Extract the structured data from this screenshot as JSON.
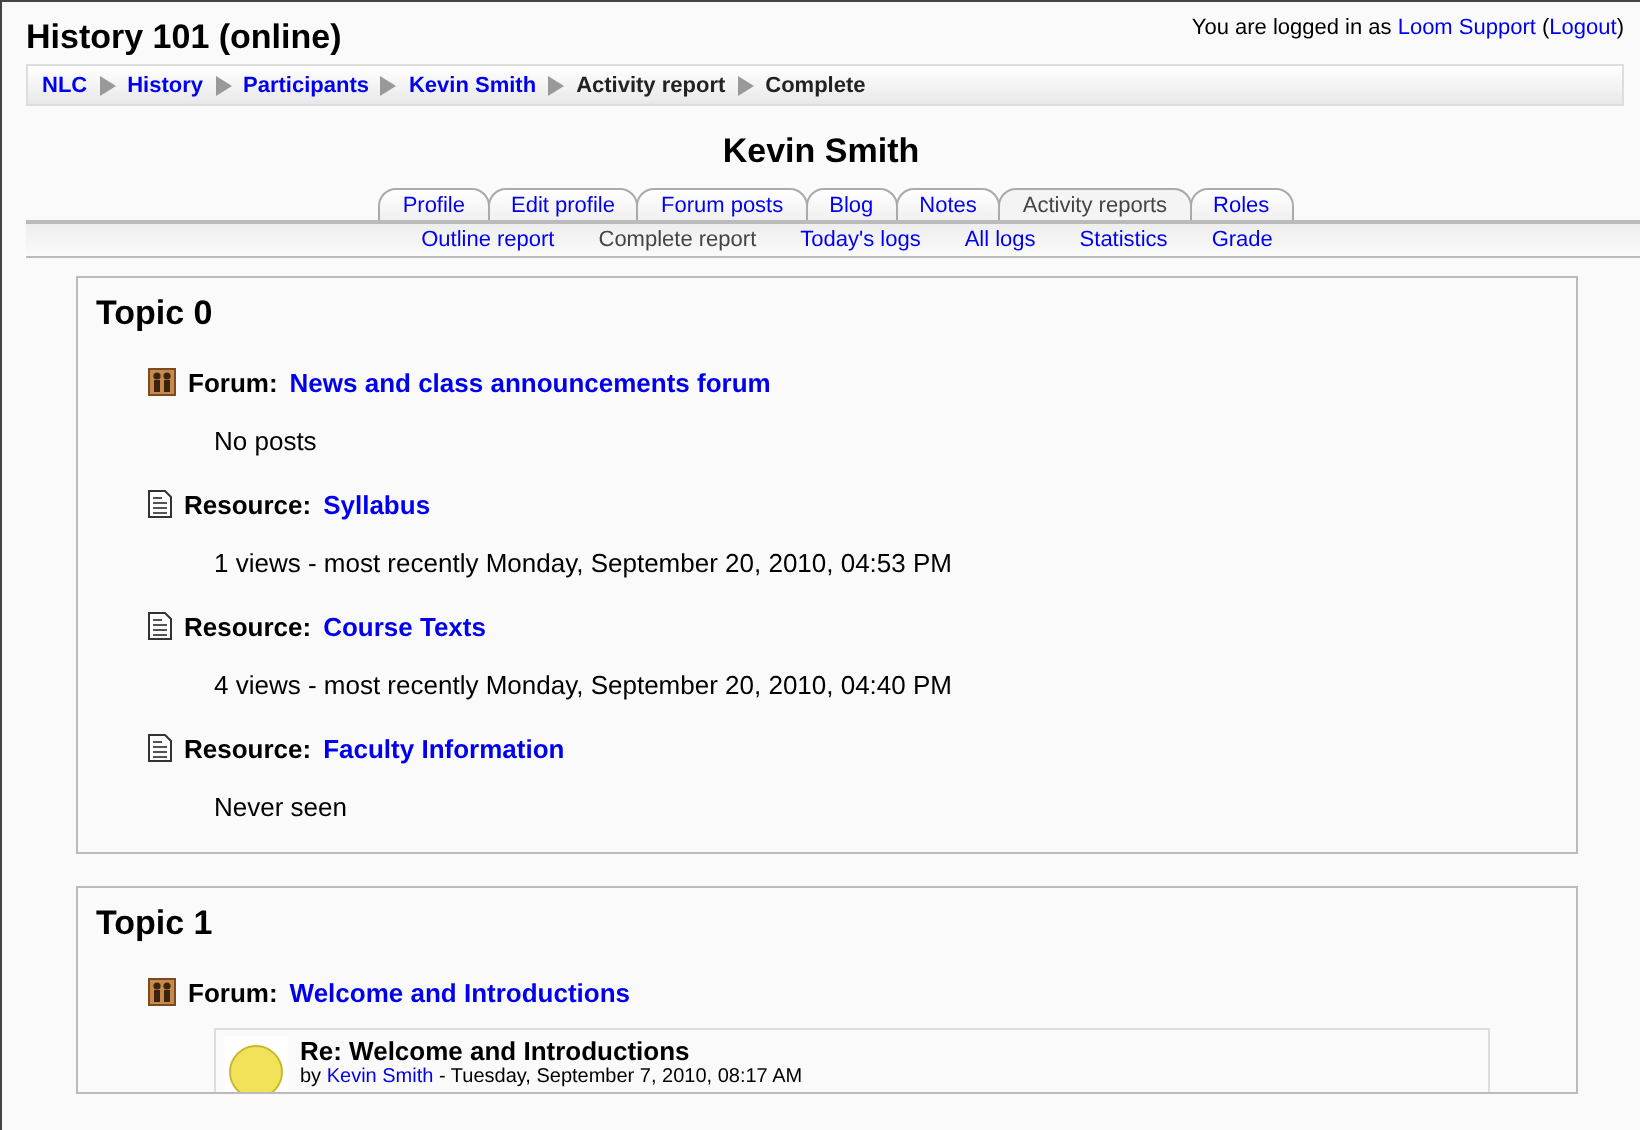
{
  "header": {
    "title": "History 101 (online)",
    "login_text": "You are logged in as",
    "user_link": "Loom Support",
    "logout_open": "(",
    "logout_link": "Logout",
    "logout_close": ")"
  },
  "breadcrumb": [
    {
      "label": "NLC",
      "link": true
    },
    {
      "label": "History",
      "link": true
    },
    {
      "label": "Participants",
      "link": true
    },
    {
      "label": "Kevin Smith",
      "link": true
    },
    {
      "label": "Activity report",
      "link": false
    },
    {
      "label": "Complete",
      "link": false
    }
  ],
  "page_title": "Kevin Smith",
  "tabs": [
    {
      "label": "Profile",
      "selected": false
    },
    {
      "label": "Edit profile",
      "selected": false
    },
    {
      "label": "Forum posts",
      "selected": false
    },
    {
      "label": "Blog",
      "selected": false
    },
    {
      "label": "Notes",
      "selected": false
    },
    {
      "label": "Activity reports",
      "selected": true
    },
    {
      "label": "Roles",
      "selected": false
    }
  ],
  "subtabs": [
    {
      "label": "Outline report",
      "selected": false
    },
    {
      "label": "Complete report",
      "selected": true
    },
    {
      "label": "Today's logs",
      "selected": false
    },
    {
      "label": "All logs",
      "selected": false
    },
    {
      "label": "Statistics",
      "selected": false
    },
    {
      "label": "Grade",
      "selected": false
    }
  ],
  "topics": [
    {
      "title": "Topic 0",
      "activities": [
        {
          "kind": "forum",
          "type_label": "Forum:",
          "name": "News and class announcements forum",
          "detail": "No posts"
        },
        {
          "kind": "resource",
          "type_label": "Resource:",
          "name": "Syllabus",
          "detail": "1 views - most recently Monday, September 20, 2010, 04:53 PM"
        },
        {
          "kind": "resource",
          "type_label": "Resource:",
          "name": "Course Texts",
          "detail": "4 views - most recently Monday, September 20, 2010, 04:40 PM"
        },
        {
          "kind": "resource",
          "type_label": "Resource:",
          "name": "Faculty Information",
          "detail": "Never seen"
        }
      ]
    },
    {
      "title": "Topic 1",
      "activities": [
        {
          "kind": "forum",
          "type_label": "Forum:",
          "name": "Welcome and Introductions",
          "post": {
            "title": "Re: Welcome and Introductions",
            "by": "by",
            "author": "Kevin Smith",
            "date": "- Tuesday, September 7, 2010, 08:17 AM"
          }
        }
      ]
    }
  ]
}
